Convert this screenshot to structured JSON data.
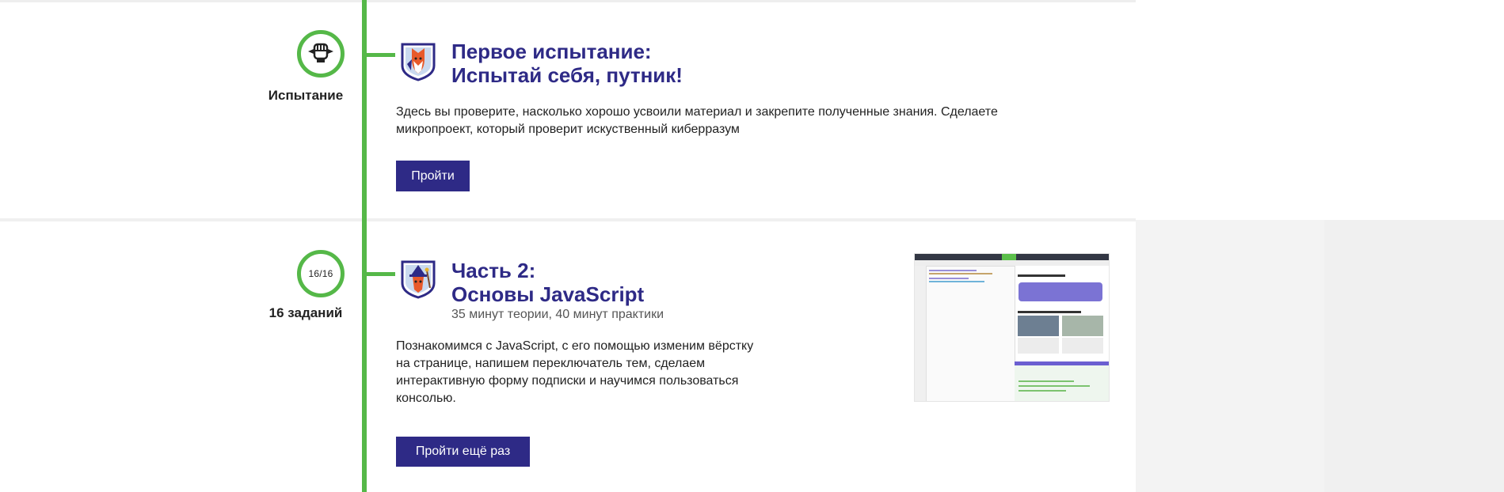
{
  "colors": {
    "timeline_green": "#55b848",
    "title_indigo": "#2e2a86",
    "button_bg": "#2e2a86",
    "button_text": "#ffffff"
  },
  "trial": {
    "node_icon": "fist-icon",
    "node_label": "Испытание",
    "badge_icon": "fox-shield-icon",
    "title_line1": "Первое испытание:",
    "title_line2": "Испытай себя, путник!",
    "description_line1": "Здесь вы проверите, насколько хорошо усвоили материал и закрепите полученные знания. Сделаете",
    "description_line2": "микропроект, который проверит искуственный киберразум",
    "button_label": "Пройти"
  },
  "part2": {
    "node_count": "16/16",
    "node_label": "16 заданий",
    "badge_icon": "wizard-shield-icon",
    "title_line1": "Часть 2:",
    "title_line2": "Основы JavaScript",
    "meta": "35 минут теории, 40 минут практики",
    "description_lines": [
      "Познакомимся с JavaScript, с его помощью изменим вёрстку",
      "на странице, напишем переключатель тем, сделаем",
      "интерактивную форму подписки и научимся пользоваться",
      "консолью."
    ],
    "button_label": "Пройти ещё раз",
    "thumbnail_icon": "course-screenshot-thumbnail"
  }
}
